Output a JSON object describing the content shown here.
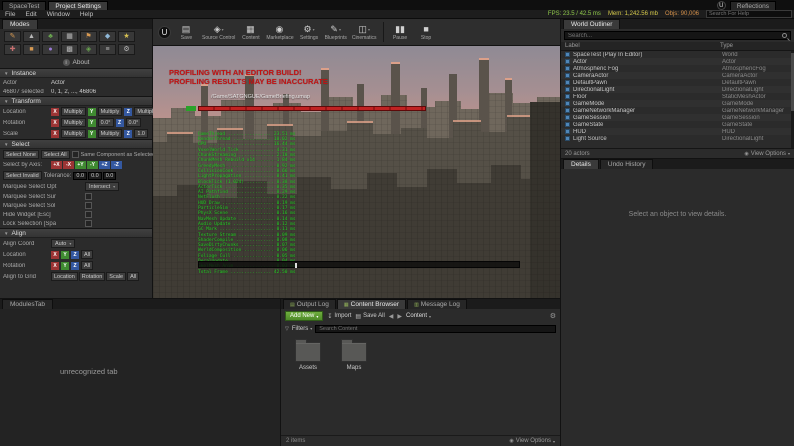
{
  "window": {
    "tabs": {
      "spacetest": "SpaceTest",
      "project_settings": "Project Settings",
      "reflections": "Reflections"
    },
    "menu": [
      "File",
      "Edit",
      "Window",
      "Help"
    ],
    "stats": {
      "fps": "FPS: 23.5 / 42.5 ms",
      "mem": "Mem: 1,242.56 mb",
      "objs": "Objs: 90,006"
    },
    "help_search_placeholder": "Search For Help",
    "engine_badge": "U"
  },
  "toolbar": {
    "items": [
      {
        "label": "Save",
        "glyph": "▤",
        "caret": ""
      },
      {
        "label": "Source Control",
        "glyph": "◈",
        "caret": "▾"
      },
      {
        "label": "Content",
        "glyph": "▦",
        "caret": ""
      },
      {
        "label": "Marketplace",
        "glyph": "◉",
        "caret": ""
      },
      {
        "label": "Settings",
        "glyph": "⚙",
        "caret": "▾"
      },
      {
        "label": "Blueprints",
        "glyph": "✎",
        "caret": "▾"
      },
      {
        "label": "Cinematics",
        "glyph": "◫",
        "caret": "▾"
      }
    ],
    "transport": [
      {
        "label": "Pause",
        "glyph": "▮▮"
      },
      {
        "label": "Stop",
        "glyph": "■"
      }
    ]
  },
  "axes": {
    "x": "X",
    "y": "Y",
    "z": "Z"
  },
  "modes": {
    "tab": "Modes",
    "about": "About",
    "tools": [
      {
        "name": "pencil-tool",
        "glyph": "✎",
        "color": "#d89a52"
      },
      {
        "name": "terrain-tool",
        "glyph": "▲",
        "color": "#b8b8b8"
      },
      {
        "name": "foliage-tool",
        "glyph": "♣",
        "color": "#6aa84f"
      },
      {
        "name": "grid-tool",
        "glyph": "▦",
        "color": "#b8b8b8"
      },
      {
        "name": "flag-tool",
        "glyph": "⚑",
        "color": "#d89a52"
      },
      {
        "name": "gem-tool",
        "glyph": "◆",
        "color": "#8fb8d8"
      },
      {
        "name": "star-tool",
        "glyph": "★",
        "color": "#d8c252"
      },
      {
        "name": "cross-tool",
        "glyph": "✚",
        "color": "#c87070"
      },
      {
        "name": "block-tool",
        "glyph": "■",
        "color": "#d89a52"
      },
      {
        "name": "sphere-tool",
        "glyph": "●",
        "color": "#9a7ad8"
      },
      {
        "name": "pattern-tool",
        "glyph": "▩",
        "color": "#b8b8b8"
      },
      {
        "name": "diamond-tool",
        "glyph": "◈",
        "color": "#6aa84f"
      },
      {
        "name": "list-tool",
        "glyph": "≡",
        "color": "#b8b8b8"
      },
      {
        "name": "gear-tool",
        "glyph": "⚙",
        "color": "#b8b8b8"
      }
    ]
  },
  "instance": {
    "title": "Instance",
    "actor_label": "Actor",
    "actor_value": "Actor",
    "selected_label": "46807 selected",
    "selected_value": "0, 1, 2, ..., 46806"
  },
  "transform": {
    "title": "Transform",
    "rows": [
      {
        "label": "Location",
        "buttons": [
          "Multiply",
          "Multiply",
          "Multiply"
        ]
      },
      {
        "label": "Rotation",
        "buttons": [
          "Multiply",
          "0.0°",
          "0.0°"
        ]
      },
      {
        "label": "Scale",
        "buttons": [
          "Multiply",
          "Multiply",
          "1.0"
        ]
      }
    ]
  },
  "select": {
    "title": "Select",
    "select_none": "Select None",
    "select_all": "Select All",
    "same_component": "Same Component as Selected",
    "by_axis_label": "Select by Axis:",
    "axes": [
      "+X",
      "-X",
      "+Y",
      "-Y",
      "+Z",
      "-Z"
    ],
    "select_invalid": "Select Invalid",
    "tolerance_label": "Tolerance:",
    "tolerances": [
      "0.0",
      "0.0",
      "0.0"
    ],
    "marquee_opt_label": "Marquee Select Opt",
    "marquee_opt_value": "Intersect",
    "marquee_sur_label": "Marquee Select Sur",
    "marquee_sol_label": "Marquee Select Sol",
    "hide_widget_label": "Hide Widget [Esc]",
    "lock_selection_label": "Lock Selection [Spa"
  },
  "align": {
    "title": "Align",
    "coord_label": "Align Coord",
    "coord_value": "Auto",
    "location_label": "Location",
    "rotation_label": "Rotation",
    "all_label": "All",
    "grid_label": "Align to Grid",
    "grid_buttons": [
      "Location",
      "Rotation",
      "Scale",
      "All"
    ]
  },
  "viewport": {
    "warnings": [
      "PROFILING WITH AN EDITOR BUILD!",
      "PROFILING RESULTS MAY BE INACCURATE"
    ],
    "path_line": "/Game/SATGNGUE/GameBriefing.umap",
    "profiler_lines": [
      "GameThread ................ 23.51 ms",
      "RenderThread .............. 18.02 ms",
      "GPU ....................... 16.44 ms",
      "VoxelWorld Tick ............ 4.31 ms",
      "ChunkStreaming ............. 2.10 ms",
      "ChunkMesh Rebuild x14 ...... 1.84 ms",
      "GreedyMesh ................. 0.92 ms",
      "CollisionCook .............. 0.66 ms",
      "LightPropagation ........... 0.41 ms",
      "BlockTick (1,024) .......... 0.38 ms",
      "ActorTick .................. 0.35 ms",
      "AI Pathfind ................ 0.29 ms",
      "NetFlush ................... 0.22 ms",
      "HUD Draw ................... 0.19 ms",
      "ParticleSim ................ 0.17 ms",
      "PhysX Scene ................ 0.16 ms",
      "NavMesh Update ............. 0.14 ms",
      "Audio Update ............... 0.12 ms",
      "GC Mark .................... 0.11 ms",
      "Texture Stream ............. 0.09 ms",
      "ShaderCompile .............. 0.08 ms",
      "SaveDirtyChunks ............ 0.07 ms",
      "WorldComposition ........... 0.06 ms",
      "Foliage Cull ............... 0.05 ms",
      "DecalUpdate ................ 0.04 ms",
      "SkelMesh Anim .............. 0.03 ms",
      "Total Frame ............... 42.50 ms"
    ]
  },
  "outliner": {
    "tab": "World Outliner",
    "search_placeholder": "Search...",
    "col_label": "Label",
    "col_type": "Type",
    "rows": [
      {
        "label": "SpaceTest (Play In Editor)",
        "type": "World"
      },
      {
        "label": "Actor",
        "type": "Actor"
      },
      {
        "label": "Atmospheric Fog",
        "type": "AtmosphericFog"
      },
      {
        "label": "CameraActor",
        "type": "CameraActor"
      },
      {
        "label": "DefaultPawn",
        "type": "DefaultPawn"
      },
      {
        "label": "DirectionalLight",
        "type": "DirectionalLight"
      },
      {
        "label": "Floor",
        "type": "StaticMeshActor"
      },
      {
        "label": "GameMode",
        "type": "GameMode"
      },
      {
        "label": "GameNetworkManager",
        "type": "GameNetworkManager"
      },
      {
        "label": "GameSession",
        "type": "GameSession"
      },
      {
        "label": "GameState",
        "type": "GameState"
      },
      {
        "label": "HUD",
        "type": "HUD"
      },
      {
        "label": "Light Source",
        "type": "DirectionalLight"
      }
    ],
    "footer_count": "20 actors",
    "view_options": "View Options"
  },
  "details": {
    "tab_details": "Details",
    "tab_undo": "Undo History",
    "empty_text": "Select an object to view details."
  },
  "content_browser": {
    "tabs": [
      {
        "label": "Output Log",
        "glyph": "▤",
        "active": false
      },
      {
        "label": "Content Browser",
        "glyph": "▦",
        "active": true
      },
      {
        "label": "Message Log",
        "glyph": "▥",
        "active": false
      }
    ],
    "add_new": "Add New",
    "import": "Import",
    "save_all": "Save All",
    "breadcrumb": "Content",
    "filters": "Filters",
    "search_placeholder": "Search Content",
    "folders": [
      {
        "name": "Assets"
      },
      {
        "name": "Maps"
      }
    ],
    "items_count": "2 items",
    "view_options": "View Options"
  },
  "misc": {
    "modules_tab": "ModulesTab",
    "unrecognized_tab": "unrecognized tab"
  }
}
